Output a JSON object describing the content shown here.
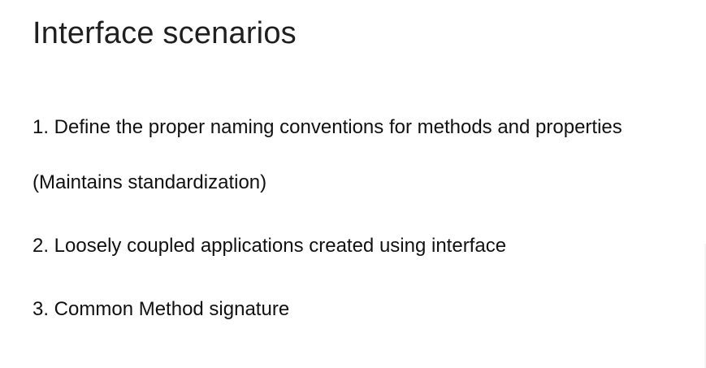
{
  "slide": {
    "title": "Interface scenarios",
    "lines": [
      "1. Define the proper naming conventions for methods and properties",
      "(Maintains standardization)",
      "2. Loosely coupled applications created using interface",
      "3. Common Method signature"
    ]
  },
  "colors": {
    "background": "#ffffff",
    "text": "#111111"
  }
}
